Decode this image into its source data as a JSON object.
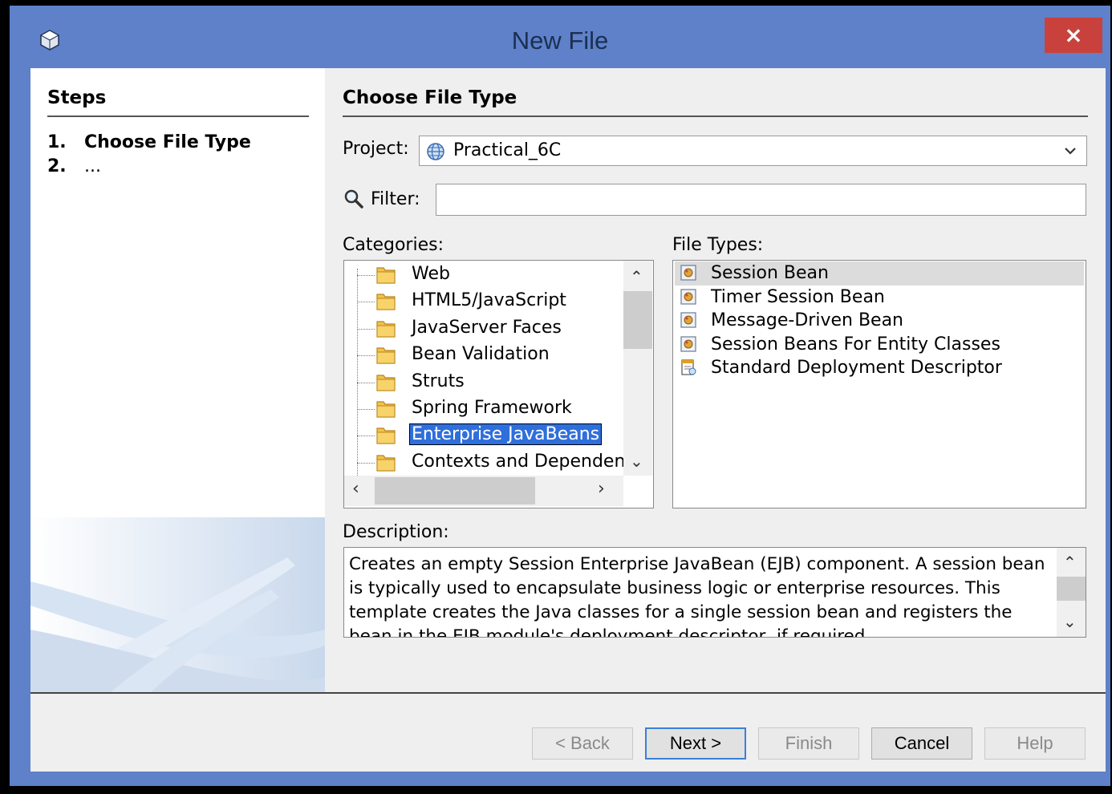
{
  "window": {
    "title": "New File",
    "close_label": "×"
  },
  "steps": {
    "heading": "Steps",
    "items": [
      {
        "num": "1.",
        "label": "Choose File Type"
      },
      {
        "num": "2.",
        "label": "..."
      }
    ]
  },
  "main": {
    "heading": "Choose File Type",
    "project_label": "Project:",
    "project_value": "Practical_6C",
    "filter_label": "Filter:",
    "filter_value": "",
    "categories_label": "Categories:",
    "file_types_label": "File Types:",
    "description_label": "Description:"
  },
  "categories": [
    "Web",
    "HTML5/JavaScript",
    "JavaServer Faces",
    "Bean Validation",
    "Struts",
    "Spring Framework",
    "Enterprise JavaBeans",
    "Contexts and Dependenc"
  ],
  "selected_category": "Enterprise JavaBeans",
  "file_types": [
    "Session Bean",
    "Timer Session Bean",
    "Message-Driven Bean",
    "Session Beans For Entity Classes",
    "Standard Deployment Descriptor"
  ],
  "selected_file_type": "Session Bean",
  "description": "Creates an empty Session Enterprise JavaBean (EJB) component. A session bean is typically used to encapsulate business logic or enterprise resources. This template creates the Java classes for a single session bean and registers the bean in the EJB module's deployment descriptor, if required.",
  "buttons": {
    "back": "< Back",
    "next": "Next >",
    "finish": "Finish",
    "cancel": "Cancel",
    "help": "Help"
  },
  "icons": {
    "app": "netbeans-cube-icon",
    "project": "globe-icon",
    "filter": "search-icon",
    "category": "folder-icon",
    "file_type": "bean-icon"
  },
  "colors": {
    "title_bar": "#5e81c9",
    "close_button": "#c9413c",
    "selection": "#2f6fdc"
  }
}
